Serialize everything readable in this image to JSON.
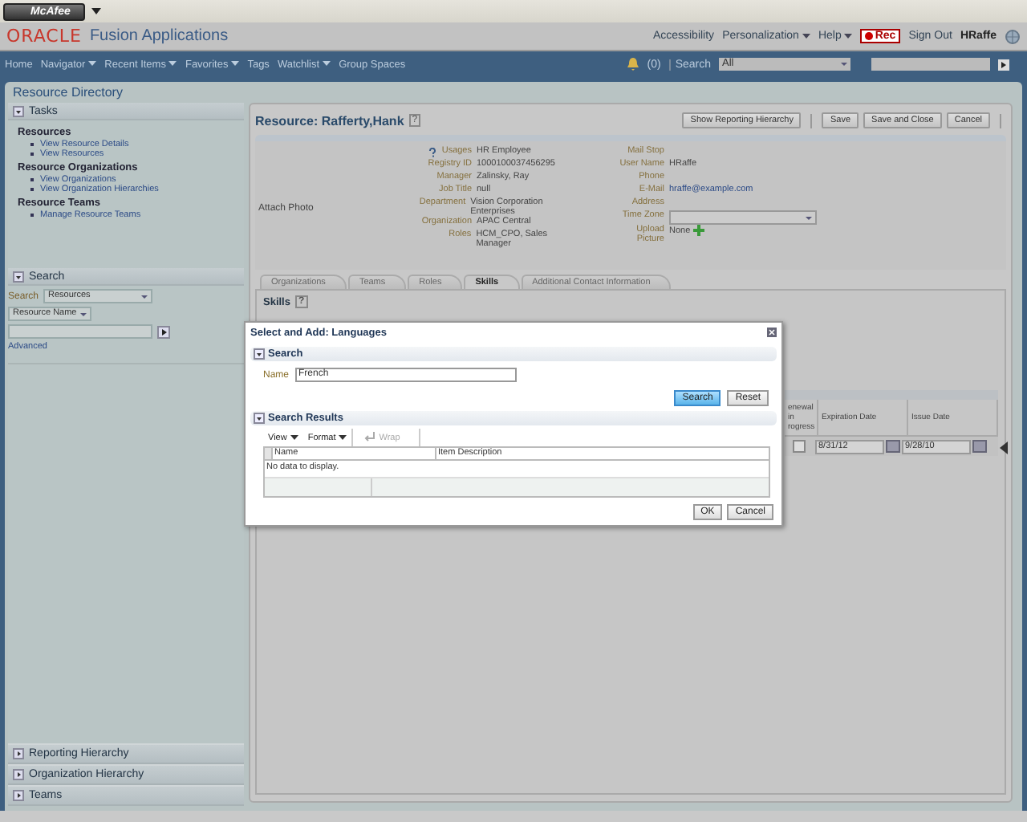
{
  "toolbar": {
    "logo": "McAfee"
  },
  "header": {
    "brand": "ORACLE",
    "product": "Fusion Applications",
    "links": [
      {
        "label": "Accessibility",
        "menu": false
      },
      {
        "label": "Personalization",
        "menu": true
      },
      {
        "label": "Help",
        "menu": true
      }
    ],
    "rec": "Rec",
    "sign_out": "Sign Out",
    "user": "HRaffe"
  },
  "nav": {
    "items": [
      {
        "label": "Home",
        "menu": false
      },
      {
        "label": "Navigator",
        "menu": true
      },
      {
        "label": "Recent Items",
        "menu": true
      },
      {
        "label": "Favorites",
        "menu": true
      },
      {
        "label": "Tags",
        "menu": false
      },
      {
        "label": "Watchlist",
        "menu": true
      },
      {
        "label": "Group Spaces",
        "menu": false
      }
    ],
    "notifications": "(0)",
    "search_label": "Search",
    "search_scope": "All"
  },
  "left": {
    "title": "Resource Directory",
    "tasks": {
      "title": "Tasks",
      "expanded": true,
      "groups": [
        {
          "heading": "Resources",
          "links": [
            "View Resource Details",
            "View Resources"
          ]
        },
        {
          "heading": "Resource Organizations",
          "links": [
            "View Organizations",
            "View Organization Hierarchies"
          ]
        },
        {
          "heading": "Resource Teams",
          "links": [
            "Manage Resource Teams"
          ]
        }
      ]
    },
    "search": {
      "title": "Search",
      "expanded": true,
      "label": "Search",
      "scope": "Resources",
      "field": "Resource Name",
      "advanced": "Advanced"
    },
    "accordions": [
      {
        "title": "Reporting Hierarchy",
        "expanded": false
      },
      {
        "title": "Organization Hierarchy",
        "expanded": false
      },
      {
        "title": "Teams",
        "expanded": false
      }
    ]
  },
  "resource": {
    "title": "Resource: Rafferty,Hank",
    "help": "?",
    "buttons": [
      "Show Reporting Hierarchy",
      "Save",
      "Save and Close",
      "Cancel"
    ],
    "attach_photo": "Attach Photo",
    "fields_left": [
      {
        "label": "Usages",
        "value": "HR Employee",
        "help": true
      },
      {
        "label": "Registry ID",
        "value": "1000100037456295",
        "help": false
      },
      {
        "label": "Manager",
        "value": "Zalinsky, Ray",
        "help": false
      },
      {
        "label": "Job Title",
        "value": "null",
        "help": false
      },
      {
        "label": "Department",
        "value": "Vision Corporation Enterprises",
        "help": false
      },
      {
        "label": "Organization",
        "value": "APAC Central",
        "help": false
      },
      {
        "label": "Roles",
        "value": "HCM_CPO, Sales Manager",
        "help": false
      }
    ],
    "fields_right": [
      {
        "label": "Mail Stop",
        "kind": "empty"
      },
      {
        "label": "User Name",
        "kind": "text",
        "value": "HRaffe"
      },
      {
        "label": "Phone",
        "kind": "empty"
      },
      {
        "label": "E-Mail",
        "kind": "link",
        "value": "hraffe@example.com"
      },
      {
        "label": "Address",
        "kind": "empty"
      },
      {
        "label": "Time Zone",
        "kind": "select"
      },
      {
        "label": "Upload Picture",
        "kind": "upload",
        "value": "None"
      }
    ],
    "tabs": [
      {
        "label": "Organizations",
        "selected": false
      },
      {
        "label": "Teams",
        "selected": false
      },
      {
        "label": "Roles",
        "selected": false
      },
      {
        "label": "Skills",
        "selected": true
      },
      {
        "label": "Additional Contact Information",
        "selected": false
      }
    ],
    "skills": {
      "title": "Skills",
      "help": "?",
      "columns": [
        "enewal in rogress",
        "Expiration Date",
        "Issue Date"
      ],
      "row": {
        "checked": false,
        "expiration": "8/31/12",
        "issue": "9/28/10"
      }
    }
  },
  "dialog": {
    "title": "Select and Add: Languages",
    "search": {
      "title": "Search",
      "expanded": true,
      "name_label": "Name",
      "name_value": "French",
      "buttons": [
        {
          "label": "Search",
          "primary": true
        },
        {
          "label": "Reset",
          "primary": false
        }
      ]
    },
    "results": {
      "title": "Search Results",
      "expanded": true,
      "tools": [
        {
          "label": "View",
          "kind": "menu",
          "disabled": false
        },
        {
          "label": "Format",
          "kind": "menu",
          "disabled": false
        },
        {
          "label": "Wrap",
          "kind": "wrap",
          "disabled": true
        }
      ],
      "columns": [
        "Name",
        "Item Description"
      ],
      "empty": "No data to display."
    },
    "buttons": [
      "OK",
      "Cancel"
    ]
  }
}
